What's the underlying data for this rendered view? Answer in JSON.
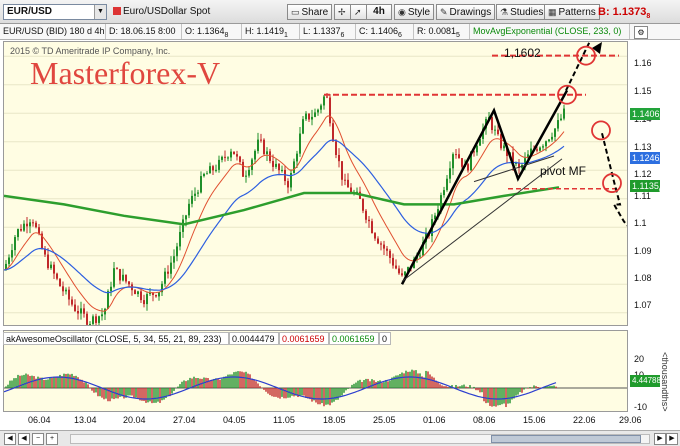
{
  "toolbar": {
    "symbol": "EUR/USD",
    "description": "Euro/USDollar Spot",
    "share": "Share",
    "interval": "4h",
    "style": "Style",
    "drawings": "Drawings",
    "studies": "Studies",
    "patterns": "Patterns",
    "bid_label": "B: 1.1373",
    "bid_suffix": "8"
  },
  "infobar": {
    "series": "EUR/USD (BID) 180 d 4h",
    "date": "D: 18.06.15 8:00",
    "open": "O: 1.1364",
    "open_s": "8",
    "high": "H: 1.1419",
    "high_s": "1",
    "low": "L: 1.1337",
    "low_s": "6",
    "close": "C: 1.1406",
    "close_s": "6",
    "range": "R: 0.0081",
    "range_s": "5",
    "study": "MovAvgExponential (CLOSE, 233, 0)"
  },
  "chart": {
    "copyright": "2015 © TD Ameritrade IP Company, Inc.",
    "brand": "Masterforex-V",
    "level_label": "1,1602",
    "pivot_label": "pivot MF",
    "price_axis": [
      "1.16",
      "1.15",
      "1.14",
      "1.13",
      "1.12",
      "1.11",
      "1.1",
      "1.09",
      "1.08",
      "1.07"
    ],
    "tags": [
      {
        "text": "1.1406",
        "color": "#22a33a"
      },
      {
        "text": "1.1246",
        "color": "#2d6fe0"
      },
      {
        "text": "1.1135",
        "color": "#1f9b2c"
      }
    ],
    "tag_suffixes": [
      "6",
      "5",
      "6"
    ]
  },
  "oscillator": {
    "name": "akAwesomeOscillator (CLOSE, 5, 34, 55, 21, 89, 233)",
    "v1": "0.0044479",
    "v2": "0.0061659",
    "v3": "0.0061659",
    "v4": "0",
    "axis": [
      "20",
      "10",
      "-10"
    ],
    "current": "4.44788",
    "vertical_label": "<thousandths>"
  },
  "xaxis": [
    "06.04",
    "13.04",
    "20.04",
    "27.04",
    "04.05",
    "11.05",
    "18.05",
    "25.05",
    "01.06",
    "08.06",
    "15.06",
    "22.06",
    "29.06"
  ],
  "colors": {
    "bull": "#1f8f2a",
    "bear": "#c0282a",
    "ema_red": "#e05030",
    "ema_blue": "#2d5fe0",
    "ema_green": "#2d9e2d",
    "level": "#e03535",
    "bg": "#fffde3"
  }
}
